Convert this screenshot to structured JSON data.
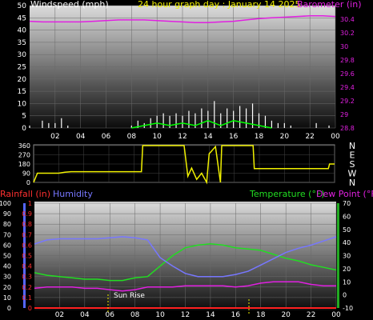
{
  "header": {
    "wind_label": "Windspeed (mph)",
    "title": "24 hour graph day : January 14 2025",
    "baro_label": "Barometer (in)"
  },
  "lower_header": {
    "rain_label": "Rainfall (in)",
    "hum_label": "Humidity",
    "temp_label": "Temperature (°F)",
    "dew_label": "Dew Point (°F)",
    "sunrise_label": "Sun Rise"
  },
  "colors": {
    "wind": "#ffffff",
    "gust": "#00ff00",
    "barometer": "#e020e0",
    "direction": "#f0f000",
    "rain_axis": "#ff3030",
    "humidity": "#7777ff",
    "temperature": "#22dd22",
    "dewpoint": "#e020e0",
    "rain": "#ff2020"
  },
  "chart_data": [
    {
      "type": "line",
      "title": "24 hour graph day : January 14 2025",
      "x_ticks": [
        "02",
        "04",
        "06",
        "08",
        "10",
        "12",
        "14",
        "16",
        "18",
        "20",
        "22",
        "00"
      ],
      "ylabel": "Windspeed (mph)",
      "ylim": [
        0,
        50
      ],
      "y_ticks": [
        "0",
        "5",
        "10",
        "15",
        "20",
        "25",
        "30",
        "35",
        "40",
        "45",
        "50"
      ],
      "y2label": "Barometer (in)",
      "y2lim": [
        28.8,
        30.6
      ],
      "y2_ticks": [
        "28.8",
        "29",
        "29.2",
        "29.4",
        "29.6",
        "29.8",
        "30",
        "30.2",
        "30.4"
      ],
      "grid": true,
      "series": [
        {
          "name": "Barometer (in)",
          "axis": "right",
          "x": [
            0,
            1,
            2,
            3,
            4,
            5,
            6,
            7,
            8,
            9,
            10,
            11,
            12,
            13,
            14,
            15,
            16,
            17,
            18,
            19,
            20,
            21,
            22,
            23,
            24
          ],
          "values": [
            30.37,
            30.36,
            30.36,
            30.36,
            30.36,
            30.37,
            30.38,
            30.39,
            30.39,
            30.39,
            30.38,
            30.37,
            30.36,
            30.35,
            30.35,
            30.36,
            30.37,
            30.39,
            30.41,
            30.42,
            30.43,
            30.44,
            30.45,
            30.45,
            30.44
          ]
        },
        {
          "name": "Windspeed (mph)",
          "axis": "left",
          "x": [
            0,
            0.5,
            1,
            1.5,
            2,
            2.5,
            3,
            3.5,
            4,
            4.5,
            5,
            5.5,
            6,
            6.5,
            7,
            7.5,
            8,
            8.5,
            9,
            9.5,
            10,
            10.5,
            11,
            11.5,
            12,
            12.5,
            13,
            13.5,
            14,
            14.5,
            15,
            15.5,
            16,
            16.5,
            17,
            17.5,
            18,
            18.5,
            19,
            19.5,
            20,
            20.5,
            21,
            21.5,
            22,
            22.5,
            23,
            23.5,
            24
          ],
          "values": [
            1,
            0,
            3,
            2,
            2,
            4,
            1,
            0,
            0,
            0,
            0,
            0,
            0,
            0,
            0,
            0,
            1,
            3,
            2,
            4,
            5,
            6,
            5,
            6,
            5,
            7,
            6,
            8,
            7,
            11,
            6,
            8,
            7,
            9,
            8,
            10,
            6,
            5,
            3,
            2,
            2,
            1,
            0,
            0,
            0,
            2,
            0,
            1,
            0
          ]
        },
        {
          "name": "Gust (mph)",
          "axis": "left",
          "x": [
            8,
            9,
            10,
            11,
            12,
            13,
            14,
            15,
            16,
            17,
            18,
            19
          ],
          "values": [
            0,
            1,
            2,
            1,
            2,
            1,
            3,
            1,
            3,
            2,
            1,
            0
          ]
        }
      ]
    },
    {
      "type": "line",
      "ylabel": "Wind direction",
      "ylim": [
        0,
        360
      ],
      "y_ticks": [
        "0",
        "90",
        "180",
        "270",
        "360"
      ],
      "y2_ticks": [
        "N",
        "W",
        "S",
        "E",
        "N"
      ],
      "x_ticks": [
        "02",
        "04",
        "06",
        "08",
        "10",
        "12",
        "14",
        "16",
        "18",
        "20",
        "22",
        "00"
      ],
      "series": [
        {
          "name": "Wind direction",
          "x": [
            0,
            0.3,
            1,
            2,
            2.5,
            3,
            4,
            6,
            8,
            8.6,
            8.7,
            10,
            11.5,
            12,
            12.3,
            12.6,
            13,
            13.4,
            13.8,
            14,
            14.5,
            14.9,
            15,
            16,
            17,
            17.5,
            17.6,
            19,
            21,
            23,
            23.5,
            23.6,
            24
          ],
          "values": [
            0,
            90,
            90,
            90,
            100,
            105,
            105,
            105,
            105,
            105,
            360,
            360,
            360,
            360,
            60,
            140,
            30,
            90,
            0,
            280,
            350,
            0,
            360,
            360,
            360,
            360,
            135,
            135,
            135,
            135,
            135,
            180,
            180
          ]
        }
      ]
    },
    {
      "type": "line",
      "x_ticks": [
        "02",
        "04",
        "06",
        "08",
        "10",
        "12",
        "14",
        "16",
        "18",
        "20",
        "22",
        "00"
      ],
      "ylabel": "Rainfall (in)",
      "ylim": [
        0,
        1.0
      ],
      "y_ticks": [
        "0",
        "0.1",
        "0.2",
        "0.3",
        "0.4",
        "0.5",
        "0.6",
        "0.7",
        "0.8",
        "0.9",
        "1"
      ],
      "y_hum_ticks": [
        "0",
        "10",
        "20",
        "30",
        "40",
        "50",
        "60",
        "70",
        "80",
        "90",
        "100"
      ],
      "y2label": "Temperature (°F)",
      "y2lim": [
        -10,
        70
      ],
      "y2_ticks": [
        "-10",
        "0",
        "10",
        "20",
        "30",
        "40",
        "50",
        "60",
        "70"
      ],
      "annotations": [
        "Sun Rise"
      ],
      "series": [
        {
          "name": "Humidity",
          "axis": "humidity",
          "x": [
            0,
            1,
            2,
            3,
            4,
            5,
            6,
            7,
            8,
            9,
            10,
            11,
            12,
            13,
            14,
            15,
            16,
            17,
            18,
            19,
            20,
            21,
            22,
            23,
            24
          ],
          "values": [
            61,
            65,
            66,
            66,
            66,
            66,
            67,
            68,
            67,
            65,
            48,
            40,
            33,
            30,
            30,
            30,
            32,
            35,
            41,
            47,
            53,
            57,
            60,
            64,
            68
          ]
        },
        {
          "name": "Temperature (°F)",
          "axis": "right",
          "x": [
            0,
            1,
            2,
            3,
            4,
            5,
            6,
            7,
            8,
            9,
            10,
            11,
            12,
            13,
            14,
            15,
            16,
            17,
            18,
            19,
            20,
            21,
            22,
            23,
            24
          ],
          "values": [
            17,
            15,
            14,
            13,
            12,
            12,
            11,
            11,
            13,
            14,
            22,
            30,
            36,
            38,
            39,
            38,
            36,
            35,
            34,
            31,
            28,
            26,
            23,
            21,
            19
          ]
        },
        {
          "name": "Dew Point (°F)",
          "axis": "right",
          "x": [
            0,
            1,
            2,
            3,
            4,
            5,
            6,
            7,
            8,
            9,
            10,
            11,
            12,
            13,
            14,
            15,
            16,
            17,
            18,
            19,
            20,
            21,
            22,
            23,
            24
          ],
          "values": [
            5,
            6,
            6,
            6,
            5,
            5,
            4,
            3,
            4,
            6,
            6,
            6,
            7,
            7,
            7,
            7,
            6,
            7,
            9,
            10,
            10,
            10,
            8,
            7,
            7
          ]
        },
        {
          "name": "Rainfall (in)",
          "axis": "left",
          "x": [
            0,
            24
          ],
          "values": [
            0,
            0
          ]
        }
      ]
    }
  ]
}
